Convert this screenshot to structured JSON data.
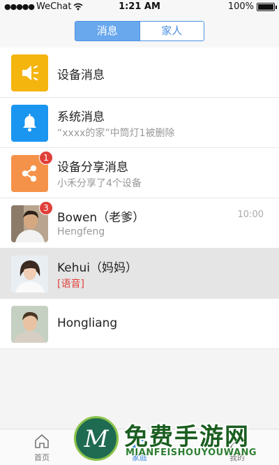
{
  "status_bar": {
    "carrier": "WeChat",
    "time": "1:21 AM",
    "battery": "100%"
  },
  "header": {
    "tabs": [
      {
        "label": "消息",
        "active": true
      },
      {
        "label": "家人",
        "active": false
      }
    ]
  },
  "messages": [
    {
      "title": "设备消息",
      "subtitle": "",
      "icon": "speaker-icon",
      "icon_color": "#f5b50f"
    },
    {
      "title": "系统消息",
      "subtitle": "“xxxx的家”中筒灯1被删除",
      "icon": "bell-icon",
      "icon_color": "#1a95f0"
    },
    {
      "title": "设备分享消息",
      "subtitle": "小禾分享了4个设备",
      "icon": "share-icon",
      "icon_color": "#f5924a",
      "badge": "1"
    },
    {
      "title": "Bowen（老爹）",
      "subtitle": "Hengfeng",
      "time": "10:00",
      "badge": "3",
      "avatar": "male-avatar"
    },
    {
      "title": "Kehui（妈妈）",
      "subtitle": "[语音]",
      "avatar": "female-avatar",
      "selected": true
    },
    {
      "title": "Hongliang",
      "subtitle": "",
      "avatar": "young-male-avatar"
    }
  ],
  "tabbar": {
    "tabs": [
      {
        "label": "首页",
        "icon": "home-icon"
      },
      {
        "label": "家庭",
        "icon": "family-icon"
      },
      {
        "label": "我的",
        "icon": "user-icon"
      }
    ]
  },
  "watermark": {
    "logo_letter": "M",
    "title": "免费手游网",
    "subtitle": "MIANFEISHOUYOUWANG"
  }
}
